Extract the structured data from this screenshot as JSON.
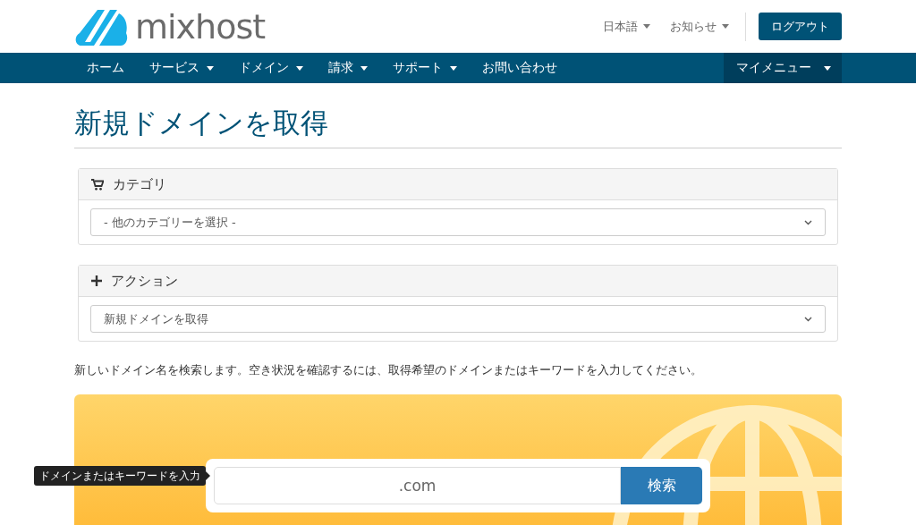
{
  "header": {
    "logo": "mixhost",
    "links": [
      {
        "label": "日本語"
      },
      {
        "label": "お知らせ"
      }
    ],
    "logout": "ログアウト"
  },
  "nav": {
    "items": [
      {
        "label": "ホーム",
        "dropdown": false
      },
      {
        "label": "サービス",
        "dropdown": true
      },
      {
        "label": "ドメイン",
        "dropdown": true
      },
      {
        "label": "請求",
        "dropdown": true
      },
      {
        "label": "サポート",
        "dropdown": true
      },
      {
        "label": "お問い合わせ",
        "dropdown": false
      }
    ],
    "my_menu": {
      "label": "マイメニュー",
      "dropdown": true
    }
  },
  "title": "新規ドメインを取得",
  "panels": [
    {
      "heading": "カテゴリ",
      "select": "- 他のカテゴリーを選択 -"
    },
    {
      "heading": "アクション",
      "select": "新規ドメインを取得"
    }
  ],
  "description": "新しいドメイン名を検索します。空き状況を確認するには、取得希望のドメインまたはキーワードを入力してください。",
  "search": {
    "placeholder": ".com",
    "button": "検索",
    "tooltip": "ドメインまたはキーワードを入力"
  }
}
